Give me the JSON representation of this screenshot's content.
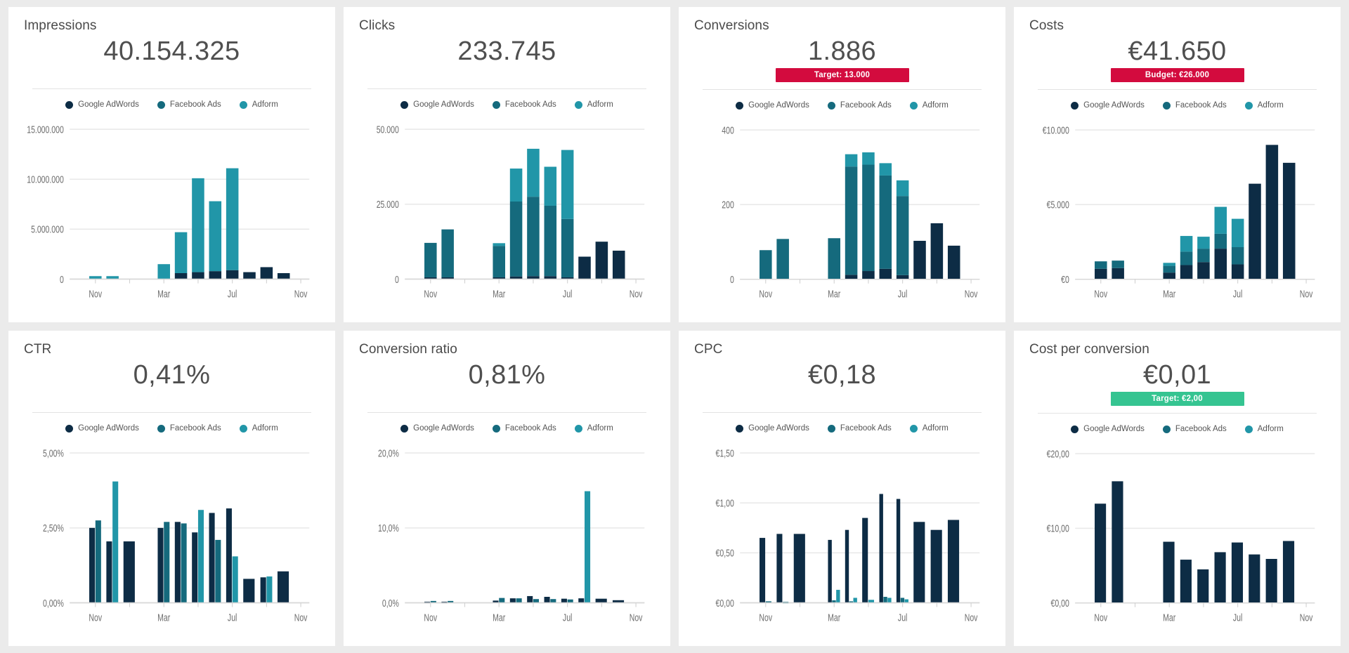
{
  "theme": {
    "background": "#ebebeb",
    "card_background": "#ffffff",
    "badge_red": "#d30b3e",
    "badge_green": "#35c491",
    "series_colors": [
      "#0d2c45",
      "#156a7d",
      "#2196a8"
    ]
  },
  "legend": {
    "items": [
      {
        "label": "Google AdWords",
        "color": "#0d2c45"
      },
      {
        "label": "Facebook Ads",
        "color": "#156a7d"
      },
      {
        "label": "Adform",
        "color": "#2196a8"
      }
    ]
  },
  "cards": [
    {
      "title": "Impressions",
      "value": "40.154.325",
      "badge": null,
      "badge_type": null
    },
    {
      "title": "Clicks",
      "value": "233.745",
      "badge": null,
      "badge_type": null
    },
    {
      "title": "Conversions",
      "value": "1.886",
      "badge": "Target: 13.000",
      "badge_type": "red"
    },
    {
      "title": "Costs",
      "value": "€41.650",
      "badge": "Budget: €26.000",
      "badge_type": "red"
    },
    {
      "title": "CTR",
      "value": "0,41%",
      "badge": null,
      "badge_type": null
    },
    {
      "title": "Conversion ratio",
      "value": "0,81%",
      "badge": null,
      "badge_type": null
    },
    {
      "title": "CPC",
      "value": "€0,18",
      "badge": null,
      "badge_type": null
    },
    {
      "title": "Cost per conversion",
      "value": "€0,01",
      "badge": "Target: €2,00",
      "badge_type": "green"
    }
  ],
  "chart_data": [
    {
      "type": "bar",
      "stacked": true,
      "title": "Impressions",
      "xlabel": "",
      "ylabel": "",
      "ylim": [
        0,
        15000000
      ],
      "yticks": [
        0,
        5000000,
        10000000,
        15000000
      ],
      "ytick_labels": [
        "0",
        "5.000.000",
        "10.000.000",
        "15.000.000"
      ],
      "xtick_positions": [
        1,
        5,
        9,
        13
      ],
      "xtick_labels": [
        "Nov",
        "Mar",
        "Jul",
        "Nov"
      ],
      "x": [
        0,
        1,
        2,
        3,
        4,
        5,
        6,
        7,
        8,
        9,
        10,
        11,
        12,
        13
      ],
      "series": [
        {
          "name": "Google AdWords",
          "color": "#0d2c45",
          "values": [
            0,
            0,
            0,
            0,
            0,
            0,
            600000,
            700000,
            800000,
            900000,
            700000,
            1200000,
            600000,
            0
          ]
        },
        {
          "name": "Facebook Ads",
          "color": "#156a7d",
          "values": [
            0,
            0,
            0,
            0,
            0,
            0,
            0,
            0,
            0,
            0,
            0,
            0,
            0,
            0
          ]
        },
        {
          "name": "Adform",
          "color": "#2196a8",
          "values": [
            0,
            300000,
            300000,
            0,
            0,
            1500000,
            4100000,
            9400000,
            7000000,
            10200000,
            0,
            0,
            0,
            0
          ]
        }
      ],
      "grid": true,
      "legend_position": "top"
    },
    {
      "type": "bar",
      "stacked": true,
      "title": "Clicks",
      "xlabel": "",
      "ylabel": "",
      "ylim": [
        0,
        50000
      ],
      "yticks": [
        0,
        25000,
        50000
      ],
      "ytick_labels": [
        "0",
        "25.000",
        "50.000"
      ],
      "xtick_positions": [
        1,
        5,
        9,
        13
      ],
      "xtick_labels": [
        "Nov",
        "Mar",
        "Jul",
        "Nov"
      ],
      "x": [
        0,
        1,
        2,
        3,
        4,
        5,
        6,
        7,
        8,
        9,
        10,
        11,
        12,
        13
      ],
      "series": [
        {
          "name": "Google AdWords",
          "color": "#0d2c45",
          "values": [
            0,
            600,
            600,
            0,
            0,
            600,
            900,
            1000,
            1000,
            600,
            7500,
            12500,
            9500,
            0
          ]
        },
        {
          "name": "Facebook Ads",
          "color": "#156a7d",
          "values": [
            0,
            11500,
            16000,
            0,
            0,
            10500,
            25000,
            26500,
            23500,
            19500,
            0,
            0,
            0,
            0
          ]
        },
        {
          "name": "Adform",
          "color": "#2196a8",
          "values": [
            0,
            0,
            0,
            0,
            0,
            900,
            11000,
            16000,
            13000,
            23000,
            0,
            0,
            0,
            0
          ]
        }
      ],
      "grid": true,
      "legend_position": "top"
    },
    {
      "type": "bar",
      "stacked": true,
      "title": "Conversions",
      "xlabel": "",
      "ylabel": "",
      "ylim": [
        0,
        400
      ],
      "yticks": [
        0,
        200,
        400
      ],
      "ytick_labels": [
        "0",
        "200",
        "400"
      ],
      "xtick_positions": [
        1,
        5,
        9,
        13
      ],
      "xtick_labels": [
        "Nov",
        "Mar",
        "Jul",
        "Nov"
      ],
      "x": [
        0,
        1,
        2,
        3,
        4,
        5,
        6,
        7,
        8,
        9,
        10,
        11,
        12,
        13
      ],
      "series": [
        {
          "name": "Google AdWords",
          "color": "#0d2c45",
          "values": [
            0,
            0,
            0,
            0,
            0,
            0,
            12,
            22,
            28,
            11,
            103,
            150,
            90,
            0
          ]
        },
        {
          "name": "Facebook Ads",
          "color": "#156a7d",
          "values": [
            0,
            78,
            108,
            0,
            0,
            110,
            290,
            285,
            250,
            212,
            0,
            0,
            0,
            0
          ]
        },
        {
          "name": "Adform",
          "color": "#2196a8",
          "values": [
            0,
            0,
            0,
            0,
            0,
            0,
            33,
            33,
            33,
            42,
            0,
            0,
            0,
            0
          ]
        }
      ],
      "grid": true,
      "legend_position": "top"
    },
    {
      "type": "bar",
      "stacked": true,
      "title": "Costs",
      "xlabel": "",
      "ylabel": "",
      "ylim": [
        0,
        10000
      ],
      "yticks": [
        0,
        5000,
        10000
      ],
      "ytick_labels": [
        "€0",
        "€5.000",
        "€10.000"
      ],
      "xtick_positions": [
        1,
        5,
        9,
        13
      ],
      "xtick_labels": [
        "Nov",
        "Mar",
        "Jul",
        "Nov"
      ],
      "x": [
        0,
        1,
        2,
        3,
        4,
        5,
        6,
        7,
        8,
        9,
        10,
        11,
        12,
        13
      ],
      "series": [
        {
          "name": "Google AdWords",
          "color": "#0d2c45",
          "values": [
            0,
            700,
            750,
            0,
            0,
            450,
            950,
            1150,
            2050,
            1000,
            6400,
            9000,
            7800,
            0
          ]
        },
        {
          "name": "Facebook Ads",
          "color": "#156a7d",
          "values": [
            0,
            500,
            500,
            0,
            0,
            450,
            900,
            900,
            1000,
            1150,
            0,
            0,
            0,
            0
          ]
        },
        {
          "name": "Adform",
          "color": "#2196a8",
          "values": [
            0,
            0,
            0,
            0,
            0,
            200,
            1050,
            800,
            1800,
            1900,
            0,
            0,
            0,
            0
          ]
        }
      ],
      "grid": true,
      "legend_position": "top"
    },
    {
      "type": "bar",
      "stacked": false,
      "title": "CTR",
      "xlabel": "",
      "ylabel": "",
      "ylim": [
        0,
        5
      ],
      "yticks": [
        0,
        2.5,
        5
      ],
      "ytick_labels": [
        "0,00%",
        "2,50%",
        "5,00%"
      ],
      "xtick_positions": [
        1,
        5,
        9,
        13
      ],
      "xtick_labels": [
        "Nov",
        "Mar",
        "Jul",
        "Nov"
      ],
      "x": [
        0,
        1,
        2,
        3,
        4,
        5,
        6,
        7,
        8,
        9,
        10,
        11,
        12,
        13
      ],
      "series": [
        {
          "name": "Google AdWords",
          "color": "#0d2c45",
          "values": [
            0,
            2.5,
            2.05,
            2.05,
            0,
            2.5,
            2.7,
            2.35,
            3.0,
            3.15,
            0.8,
            0.85,
            1.05,
            0
          ]
        },
        {
          "name": "Facebook Ads",
          "color": "#156a7d",
          "values": [
            0,
            2.75,
            0,
            0,
            0,
            2.7,
            2.65,
            0,
            2.1,
            0,
            0,
            0,
            0,
            0
          ]
        },
        {
          "name": "Adform",
          "color": "#2196a8",
          "values": [
            0,
            0,
            4.05,
            0,
            0,
            0,
            0,
            3.1,
            0,
            1.55,
            0,
            0.88,
            0,
            0
          ]
        }
      ],
      "grid": true,
      "legend_position": "top"
    },
    {
      "type": "bar",
      "stacked": false,
      "title": "Conversion ratio",
      "xlabel": "",
      "ylabel": "",
      "ylim": [
        0,
        20
      ],
      "yticks": [
        0,
        10,
        20
      ],
      "ytick_labels": [
        "0,0%",
        "10,0%",
        "20,0%"
      ],
      "xtick_positions": [
        1,
        5,
        9,
        13
      ],
      "xtick_labels": [
        "Nov",
        "Mar",
        "Jul",
        "Nov"
      ],
      "x": [
        0,
        1,
        2,
        3,
        4,
        5,
        6,
        7,
        8,
        9,
        10,
        11,
        12,
        13
      ],
      "series": [
        {
          "name": "Google AdWords",
          "color": "#0d2c45",
          "values": [
            0,
            0.15,
            0.15,
            0,
            0,
            0.3,
            0.6,
            0.9,
            0.8,
            0.55,
            0.6,
            0.55,
            0.35,
            0
          ]
        },
        {
          "name": "Facebook Ads",
          "color": "#156a7d",
          "values": [
            0,
            0.25,
            0.25,
            0,
            0,
            0.65,
            0.6,
            0.5,
            0.5,
            0.45,
            0,
            0,
            0,
            0
          ]
        },
        {
          "name": "Adform",
          "color": "#2196a8",
          "values": [
            0,
            0,
            0,
            0,
            0,
            0,
            0,
            0,
            0,
            0,
            14.9,
            0,
            0,
            0
          ]
        }
      ],
      "grid": true,
      "legend_position": "top"
    },
    {
      "type": "bar",
      "stacked": false,
      "title": "CPC",
      "xlabel": "",
      "ylabel": "",
      "ylim": [
        0,
        1.5
      ],
      "yticks": [
        0,
        0.5,
        1.0,
        1.5
      ],
      "ytick_labels": [
        "€0,00",
        "€0,50",
        "€1,00",
        "€1,50"
      ],
      "xtick_positions": [
        1,
        5,
        9,
        13
      ],
      "xtick_labels": [
        "Nov",
        "Mar",
        "Jul",
        "Nov"
      ],
      "x": [
        0,
        1,
        2,
        3,
        4,
        5,
        6,
        7,
        8,
        9,
        10,
        11,
        12,
        13
      ],
      "series": [
        {
          "name": "Google AdWords",
          "color": "#0d2c45",
          "values": [
            0,
            0.65,
            0.69,
            0.69,
            0,
            0.63,
            0.73,
            0.85,
            1.09,
            1.04,
            0.81,
            0.73,
            0.83,
            0
          ]
        },
        {
          "name": "Facebook Ads",
          "color": "#156a7d",
          "values": [
            0,
            0.015,
            0.01,
            0,
            0,
            0.025,
            0.015,
            0,
            0.06,
            0.05,
            0,
            0,
            0,
            0
          ]
        },
        {
          "name": "Adform",
          "color": "#2196a8",
          "values": [
            0,
            0,
            0,
            0,
            0,
            0.13,
            0.05,
            0.03,
            0.05,
            0.035,
            0,
            0,
            0,
            0
          ]
        }
      ],
      "grid": true,
      "legend_position": "top"
    },
    {
      "type": "bar",
      "stacked": false,
      "title": "Cost per conversion",
      "xlabel": "",
      "ylabel": "",
      "ylim": [
        0,
        20
      ],
      "yticks": [
        0,
        10,
        20
      ],
      "ytick_labels": [
        "€0,00",
        "€10,00",
        "€20,00"
      ],
      "xtick_positions": [
        1,
        5,
        9,
        13
      ],
      "xtick_labels": [
        "Nov",
        "Mar",
        "Jul",
        "Nov"
      ],
      "x": [
        0,
        1,
        2,
        3,
        4,
        5,
        6,
        7,
        8,
        9,
        10,
        11,
        12,
        13
      ],
      "series": [
        {
          "name": "Google AdWords",
          "color": "#0d2c45",
          "values": [
            0,
            13.3,
            16.3,
            0,
            0,
            8.2,
            5.8,
            4.5,
            6.8,
            8.1,
            6.5,
            5.9,
            8.3,
            0
          ]
        },
        {
          "name": "Facebook Ads",
          "color": "#156a7d",
          "values": [
            0,
            0,
            0,
            0,
            0,
            0,
            0,
            0,
            0,
            0,
            0,
            0,
            0,
            0
          ]
        },
        {
          "name": "Adform",
          "color": "#2196a8",
          "values": [
            0,
            0,
            0,
            0,
            0,
            0,
            0,
            0,
            0,
            0,
            0,
            0,
            0,
            0
          ]
        }
      ],
      "grid": true,
      "legend_position": "top"
    }
  ]
}
